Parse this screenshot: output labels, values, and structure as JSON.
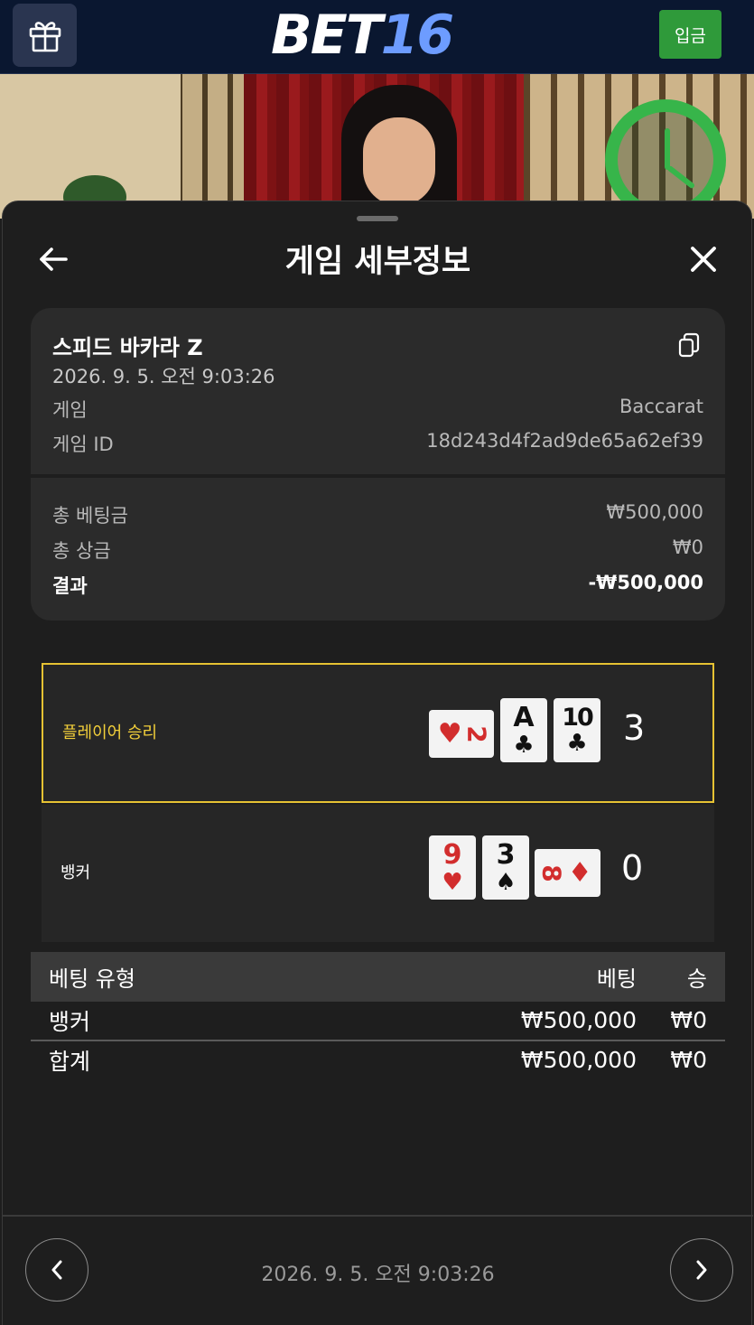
{
  "header": {
    "logo_part1": "BET",
    "logo_part2": "16",
    "deposit_label": "입금"
  },
  "sheet": {
    "title": "게임 세부정보"
  },
  "game_info": {
    "name": "스피드 바카라 Z",
    "datetime": "2026. 9. 5. 오전 9:03:26",
    "game_label": "게임",
    "game_value": "Baccarat",
    "game_id_label": "게임 ID",
    "game_id_value": "18d243d4f2ad9de65a62ef39",
    "total_bet_label": "총 베팅금",
    "total_bet_value": "₩500,000",
    "total_win_label": "총 상금",
    "total_win_value": "₩0",
    "result_label": "결과",
    "result_value": "-₩500,000"
  },
  "hands": {
    "player": {
      "label": "플레이어 승리",
      "score": "3",
      "cards": [
        {
          "rank": "2",
          "suit": "♥",
          "color": "#d22d2d",
          "orientation": "sideways"
        },
        {
          "rank": "A",
          "suit": "♣",
          "color": "#111111",
          "orientation": "upright"
        },
        {
          "rank": "10",
          "suit": "♣",
          "color": "#111111",
          "orientation": "upright"
        }
      ]
    },
    "banker": {
      "label": "뱅커",
      "score": "0",
      "cards": [
        {
          "rank": "9",
          "suit": "♥",
          "color": "#d22d2d",
          "orientation": "upright"
        },
        {
          "rank": "3",
          "suit": "♠",
          "color": "#111111",
          "orientation": "upright"
        },
        {
          "rank": "8",
          "suit": "♦",
          "color": "#d22d2d",
          "orientation": "sideways"
        }
      ]
    }
  },
  "bets_table": {
    "headers": [
      "베팅 유형",
      "베팅",
      "승"
    ],
    "rows": [
      {
        "type": "뱅커",
        "bet": "₩500,000",
        "win": "₩0"
      }
    ],
    "total": {
      "type": "합계",
      "bet": "₩500,000",
      "win": "₩0"
    }
  },
  "footer": {
    "datetime": "2026. 9. 5. 오전 9:03:26"
  },
  "icons": {
    "gift": "gift-icon",
    "copy": "copy-icon",
    "back": "arrow-left-icon",
    "close": "close-icon",
    "prev": "chevron-left-icon",
    "next": "chevron-right-icon",
    "timer": "clock-icon"
  },
  "colors": {
    "topbar": "#0a1730",
    "deposit": "#2f9a3a",
    "winner_border": "#e6c233",
    "winner_text": "#f2cf3a",
    "timer": "#37b54a"
  }
}
